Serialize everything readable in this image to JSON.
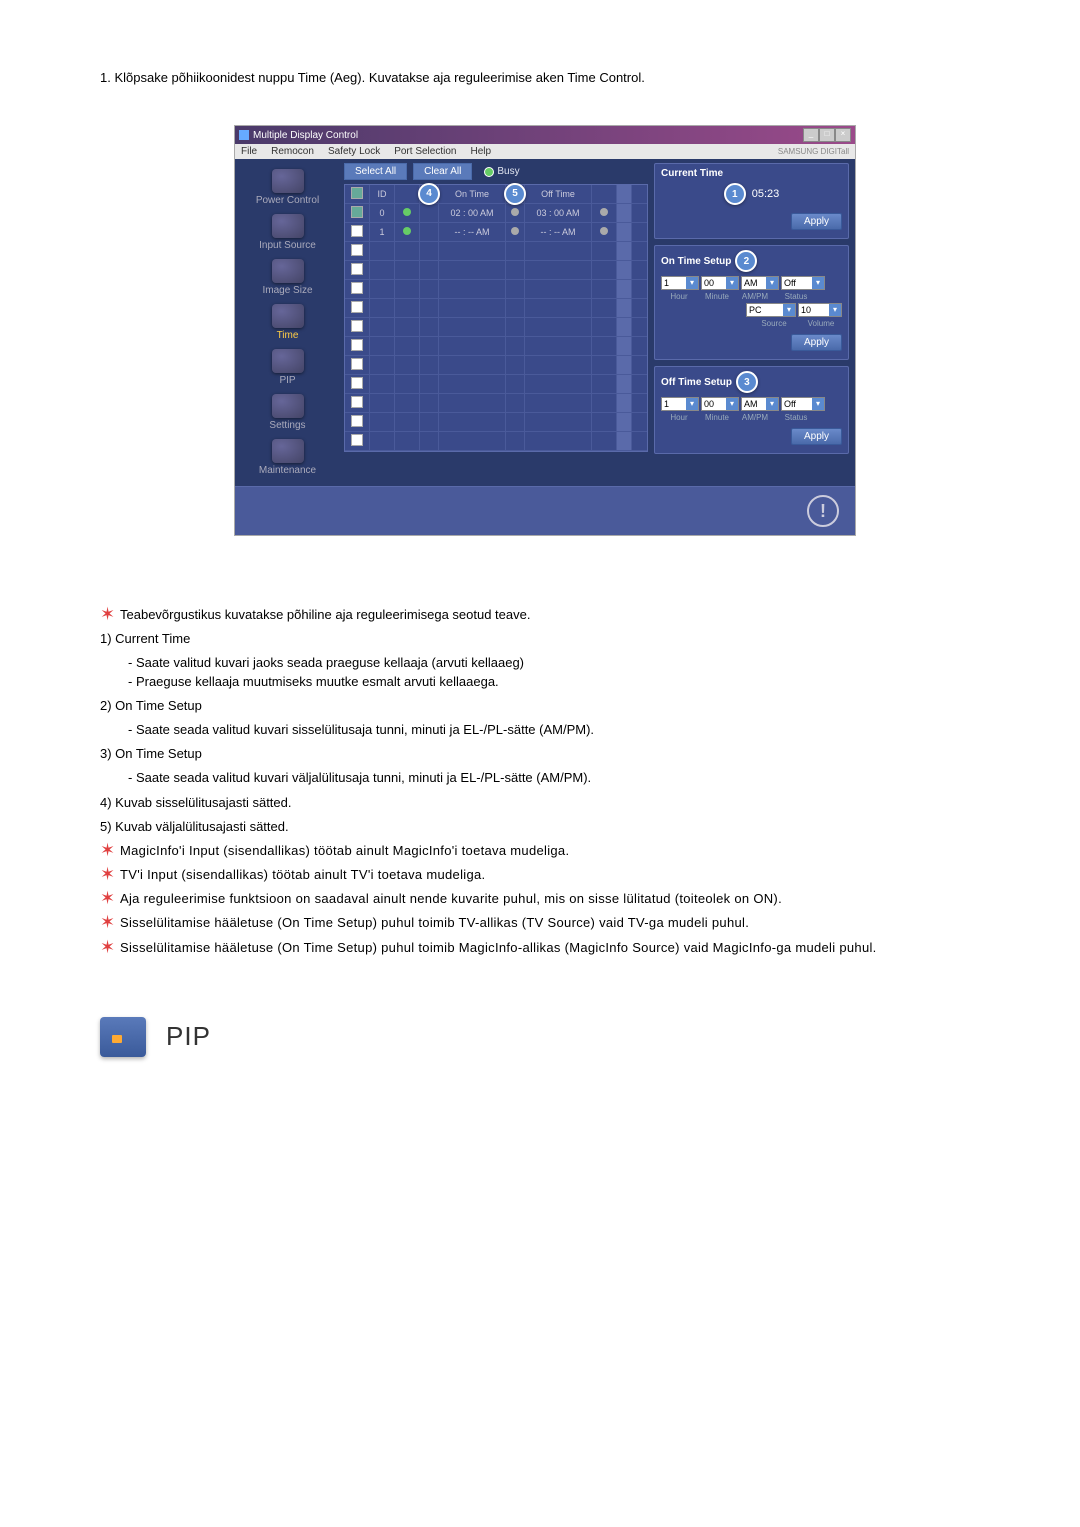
{
  "instruction": "1.  Klõpsake põhiikoonidest nuppu Time (Aeg). Kuvatakse aja reguleerimise aken Time Control.",
  "app": {
    "title": "Multiple Display Control",
    "menu": [
      "File",
      "Remocon",
      "Safety Lock",
      "Port Selection",
      "Help"
    ],
    "brand": "SAMSUNG DIGITall"
  },
  "sidebar": {
    "items": [
      {
        "label": "Power Control"
      },
      {
        "label": "Input Source"
      },
      {
        "label": "Image Size"
      },
      {
        "label": "Time"
      },
      {
        "label": "PIP"
      },
      {
        "label": "Settings"
      },
      {
        "label": "Maintenance"
      }
    ]
  },
  "toolbar": {
    "select_all": "Select All",
    "clear_all": "Clear All",
    "busy": "Busy"
  },
  "table": {
    "headers": {
      "id": "ID",
      "on_time": "On Time",
      "off_time": "Off Time"
    },
    "rows": [
      {
        "checked": true,
        "id": "0",
        "st1": "green",
        "on": "02 : 00 AM",
        "st2": "gray",
        "off": "03 : 00 AM",
        "st3": "gray"
      },
      {
        "checked": false,
        "id": "1",
        "st1": "green",
        "on": "-- : -- AM",
        "st2": "gray",
        "off": "-- : -- AM",
        "st3": "gray"
      }
    ],
    "callout4": "4",
    "callout5": "5"
  },
  "right": {
    "current_time": {
      "title": "Current Time",
      "callout": "1",
      "value": "05:23",
      "apply": "Apply"
    },
    "on_time": {
      "title": "On Time Setup",
      "callout": "2",
      "hour": "1",
      "minute": "00",
      "ampm": "AM",
      "status": "Off",
      "source": "PC",
      "volume": "10",
      "labels": {
        "hour": "Hour",
        "minute": "Minute",
        "ampm": "AM/PM",
        "status": "Status",
        "source": "Source",
        "volume": "Volume"
      },
      "apply": "Apply"
    },
    "off_time": {
      "title": "Off Time Setup",
      "callout": "3",
      "hour": "1",
      "minute": "00",
      "ampm": "AM",
      "status": "Off",
      "labels": {
        "hour": "Hour",
        "minute": "Minute",
        "ampm": "AM/PM",
        "status": "Status"
      },
      "apply": "Apply"
    }
  },
  "notes": {
    "star1": "Teabevõrgustikus kuvatakse põhiline aja reguleerimisega seotud teave.",
    "n1_title": "1) Current Time",
    "n1_a": "- Saate valitud kuvari jaoks seada praeguse kellaaja (arvuti kellaaeg)",
    "n1_b": "- Praeguse kellaaja muutmiseks muutke esmalt arvuti kellaaega.",
    "n2_title": "2) On Time Setup",
    "n2_a": "- Saate seada valitud kuvari sisselülitusaja tunni, minuti ja EL-/PL-sätte (AM/PM).",
    "n3_title": "3) On Time Setup",
    "n3_a": "- Saate seada valitud kuvari väljalülitusaja tunni, minuti ja EL-/PL-sätte (AM/PM).",
    "n4": "4) Kuvab sisselülitusajasti sätted.",
    "n5": "5) Kuvab väljalülitusajasti sätted.",
    "star2": "MagicInfo'i Input (sisendallikas) töötab ainult MagicInfo'i toetava mudeliga.",
    "star3": "TV'i Input (sisendallikas) töötab ainult TV'i toetava mudeliga.",
    "star4": "Aja reguleerimise funktsioon on saadaval ainult nende kuvarite puhul, mis on sisse lülitatud (toiteolek on ON).",
    "star5": "Sisselülitamise hääletuse (On Time Setup) puhul toimib TV-allikas (TV Source) vaid TV-ga mudeli puhul.",
    "star6": "Sisselülitamise hääletuse (On Time Setup) puhul toimib MagicInfo-allikas (MagicInfo Source) vaid MagicInfo-ga mudeli puhul."
  },
  "pip": {
    "title": "PIP"
  }
}
